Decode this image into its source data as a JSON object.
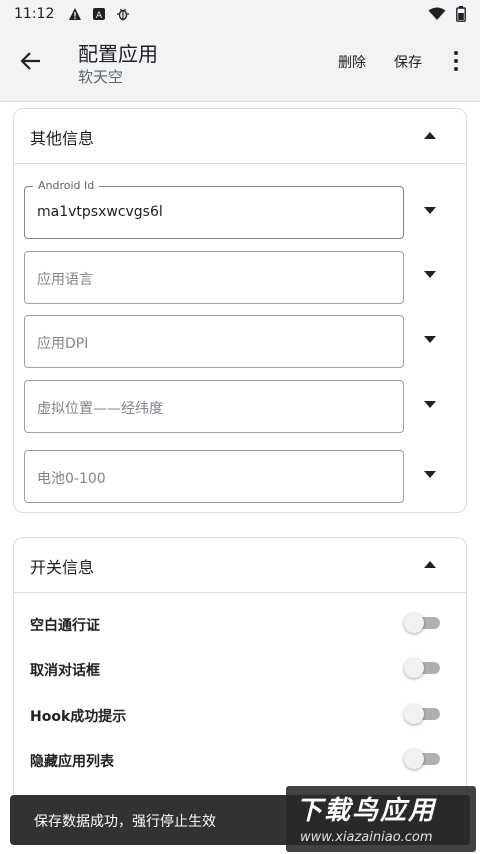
{
  "status_bar": {
    "time": "11:12",
    "icons": [
      "alert-icon",
      "a-box-icon",
      "bug-icon",
      "wifi-icon",
      "battery-icon"
    ]
  },
  "app_bar": {
    "title": "配置应用",
    "subtitle": "软天空",
    "delete_label": "删除",
    "save_label": "保存"
  },
  "other_info": {
    "title": "其他信息",
    "fields": [
      {
        "label": "Android Id",
        "value": "ma1vtpsxwcvgs6l"
      },
      {
        "placeholder": "应用语言"
      },
      {
        "placeholder": "应用DPI"
      },
      {
        "placeholder": "虚拟位置——经纬度"
      },
      {
        "placeholder": "电池0-100"
      }
    ]
  },
  "switch_info": {
    "title": "开关信息",
    "items": [
      {
        "label": "空白通行证",
        "on": false
      },
      {
        "label": "取消对话框",
        "on": false
      },
      {
        "label": "Hook成功提示",
        "on": false
      },
      {
        "label": "隐藏应用列表",
        "on": false
      }
    ]
  },
  "toast": {
    "message": "保存数据成功，强行停止生效"
  },
  "watermark": {
    "title": "下载鸟应用",
    "url": "www.xiazainiao.com"
  }
}
